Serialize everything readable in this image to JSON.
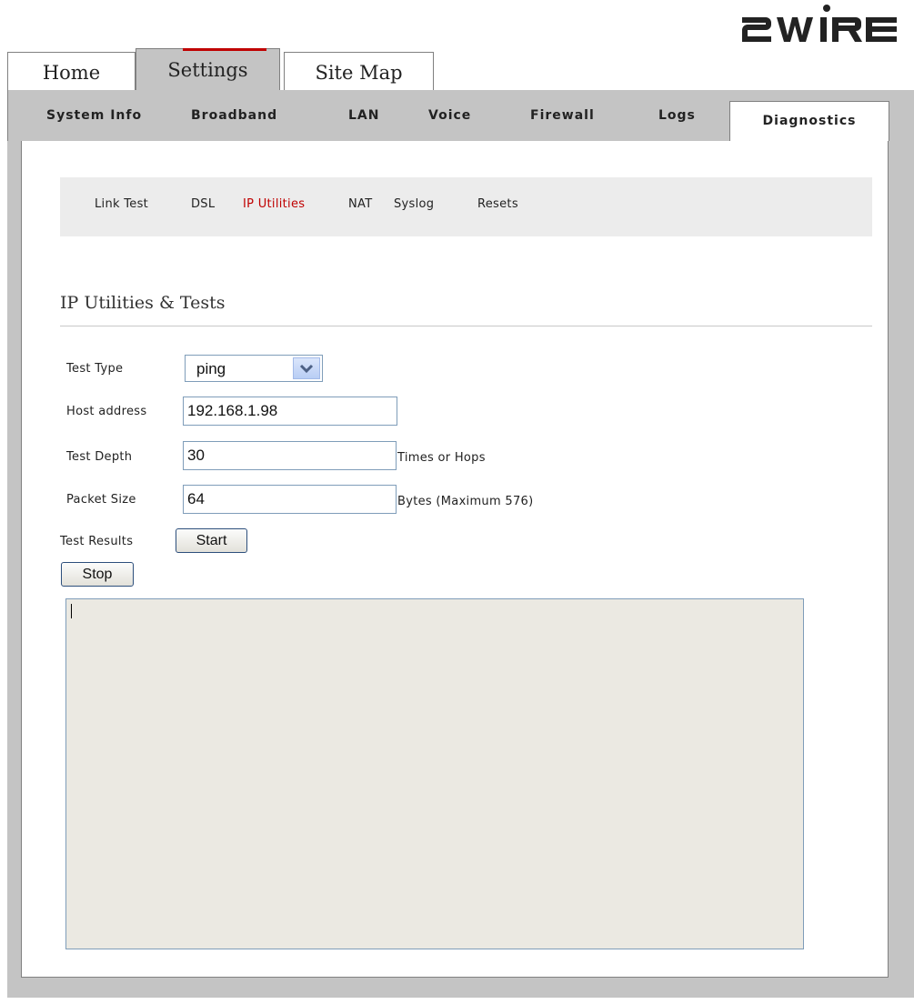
{
  "logo": {
    "text": "2WIRE"
  },
  "top_tabs": [
    {
      "label": "Home",
      "selected": false
    },
    {
      "label": "Settings",
      "selected": true
    },
    {
      "label": "Site Map",
      "selected": false
    }
  ],
  "nav": {
    "items": [
      "System Info",
      "Broadband",
      "LAN",
      "Voice",
      "Firewall",
      "Logs"
    ],
    "active": "Diagnostics"
  },
  "submenu": {
    "items": [
      "Link Test",
      "DSL",
      "IP Utilities",
      "NAT",
      "Syslog",
      "Resets"
    ],
    "active_index": 2
  },
  "section": {
    "title": "IP Utilities & Tests"
  },
  "form": {
    "test_type": {
      "label": "Test Type",
      "value": "ping"
    },
    "host_address": {
      "label": "Host address",
      "value": "192.168.1.98"
    },
    "test_depth": {
      "label": "Test Depth",
      "value": "30",
      "hint": "Times or Hops"
    },
    "packet_size": {
      "label": "Packet Size",
      "value": "64",
      "hint": "Bytes (Maximum 576)"
    },
    "test_results": {
      "label": "Test Results"
    },
    "start_label": "Start",
    "stop_label": "Stop",
    "results_text": ""
  },
  "colors": {
    "accent_red": "#c00000",
    "frame_gray": "#c4c4c4",
    "submenu_bg": "#ececec",
    "results_bg": "#ebe9e2",
    "input_border": "#7f9db9"
  }
}
